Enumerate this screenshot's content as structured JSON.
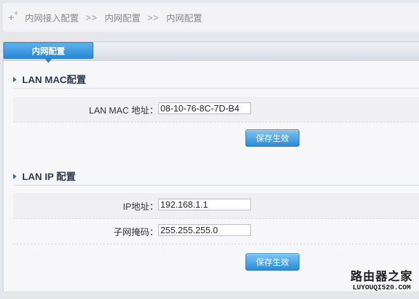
{
  "breadcrumb": {
    "items": [
      "内网接入配置",
      "内网配置",
      "内网配置"
    ],
    "separator": ">>"
  },
  "tab": {
    "label": "内网配置"
  },
  "mac_section": {
    "title": "LAN MAC配置",
    "field_label": "LAN MAC 地址：",
    "field_value": "08-10-76-8C-7D-B4",
    "button_label": "保存生效"
  },
  "ip_section": {
    "title": "LAN IP 配置",
    "ip_label": "IP地址：",
    "ip_value": "192.168.1.1",
    "mask_label": "子网掩码：",
    "mask_value": "255.255.255.0",
    "button_label": "保存生效"
  },
  "watermark": {
    "top": "路由器之家",
    "bottom": "LUYOUQI520.COM"
  },
  "colors": {
    "accent": "#2a86d8",
    "title_text": "#2d3b50"
  }
}
